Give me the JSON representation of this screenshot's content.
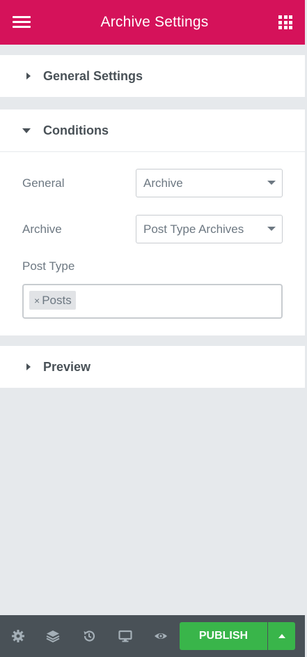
{
  "header": {
    "title": "Archive Settings"
  },
  "sections": {
    "general_settings": {
      "label": "General Settings",
      "expanded": false
    },
    "conditions": {
      "label": "Conditions",
      "expanded": true,
      "fields": {
        "general": {
          "label": "General",
          "value": "Archive"
        },
        "archive": {
          "label": "Archive",
          "value": "Post Type Archives"
        },
        "post_type": {
          "label": "Post Type",
          "tags": [
            "Posts"
          ],
          "remove_glyph": "×"
        }
      }
    },
    "preview": {
      "label": "Preview",
      "expanded": false
    }
  },
  "footer": {
    "icons": [
      "gear-icon",
      "layers-icon",
      "history-icon",
      "desktop-icon",
      "eye-icon"
    ],
    "publish_label": "PUBLISH"
  },
  "colors": {
    "header_bg": "#d5125a",
    "publish_bg": "#39b54a",
    "footer_bg": "#495157",
    "panel_bg": "#e6e9ec"
  }
}
